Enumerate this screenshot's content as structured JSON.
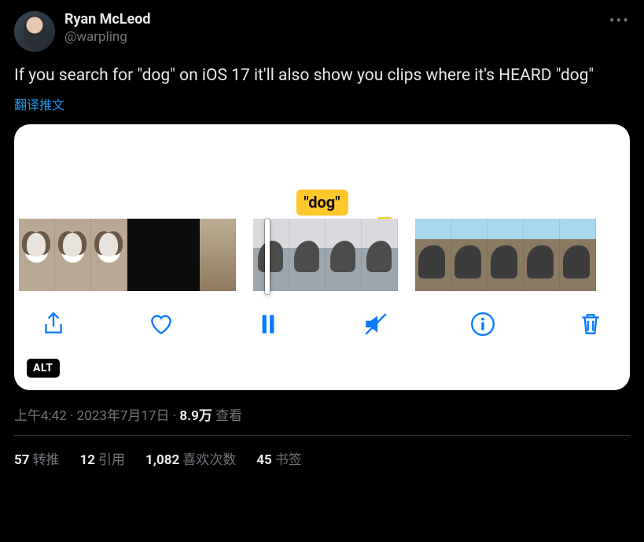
{
  "author": {
    "display_name": "Ryan McLeod",
    "handle": "@warpling"
  },
  "more_label": "•••",
  "body_text": "If you search for \"dog\" on iOS 17 it'll also show you clips where it's HEARD \"dog\"",
  "translate_label": "翻译推文",
  "media": {
    "badge_text": "\"dog\"",
    "alt_label": "ALT",
    "icons": {
      "share": "share-icon",
      "like": "heart-icon",
      "pause": "pause-icon",
      "mute": "mute-icon",
      "info": "info-icon",
      "trash": "trash-icon"
    }
  },
  "meta": {
    "time": "上午4:42",
    "sep1": " · ",
    "date": "2023年7月17日",
    "sep2": " · ",
    "views_count": "8.9万",
    "views_label": " 查看"
  },
  "stats": {
    "retweets_count": "57",
    "retweets_label": "转推",
    "quotes_count": "12",
    "quotes_label": "引用",
    "likes_count": "1,082",
    "likes_label": "喜欢次数",
    "bookmarks_count": "45",
    "bookmarks_label": "书签"
  }
}
